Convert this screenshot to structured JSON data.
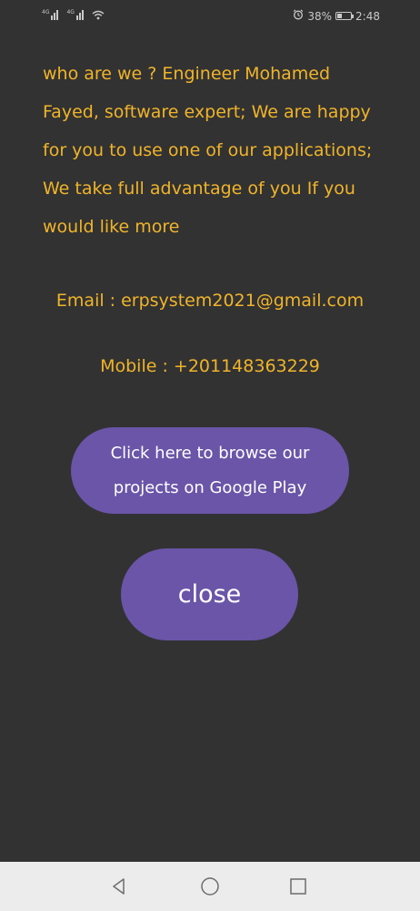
{
  "status_bar": {
    "sim1_tag": "4G",
    "sim2_tag": "4G",
    "battery_percent_text": "38%",
    "battery_level": 0.38,
    "time": "2:48",
    "icons": [
      "signal-icon",
      "signal-icon",
      "wifi-icon",
      "alarm-icon",
      "battery-icon"
    ]
  },
  "about": {
    "text": "who are we ? Engineer Mohamed Fayed, software expert; We are happy for you to use one of our applications; We take full advantage of you If you would like more",
    "email": "Email  : erpsystem2021@gmail.com",
    "mobile": "Mobile : +201148363229"
  },
  "buttons": {
    "browse_label": "Click here to browse our projects on Google Play",
    "close_label": "close"
  },
  "nav_bar": {
    "icons": [
      "back-icon",
      "home-icon",
      "recents-icon"
    ]
  },
  "colors": {
    "background": "#323233",
    "text_accent": "#f0b429",
    "button": "#6a55a8",
    "nav_bar": "#ececec"
  }
}
